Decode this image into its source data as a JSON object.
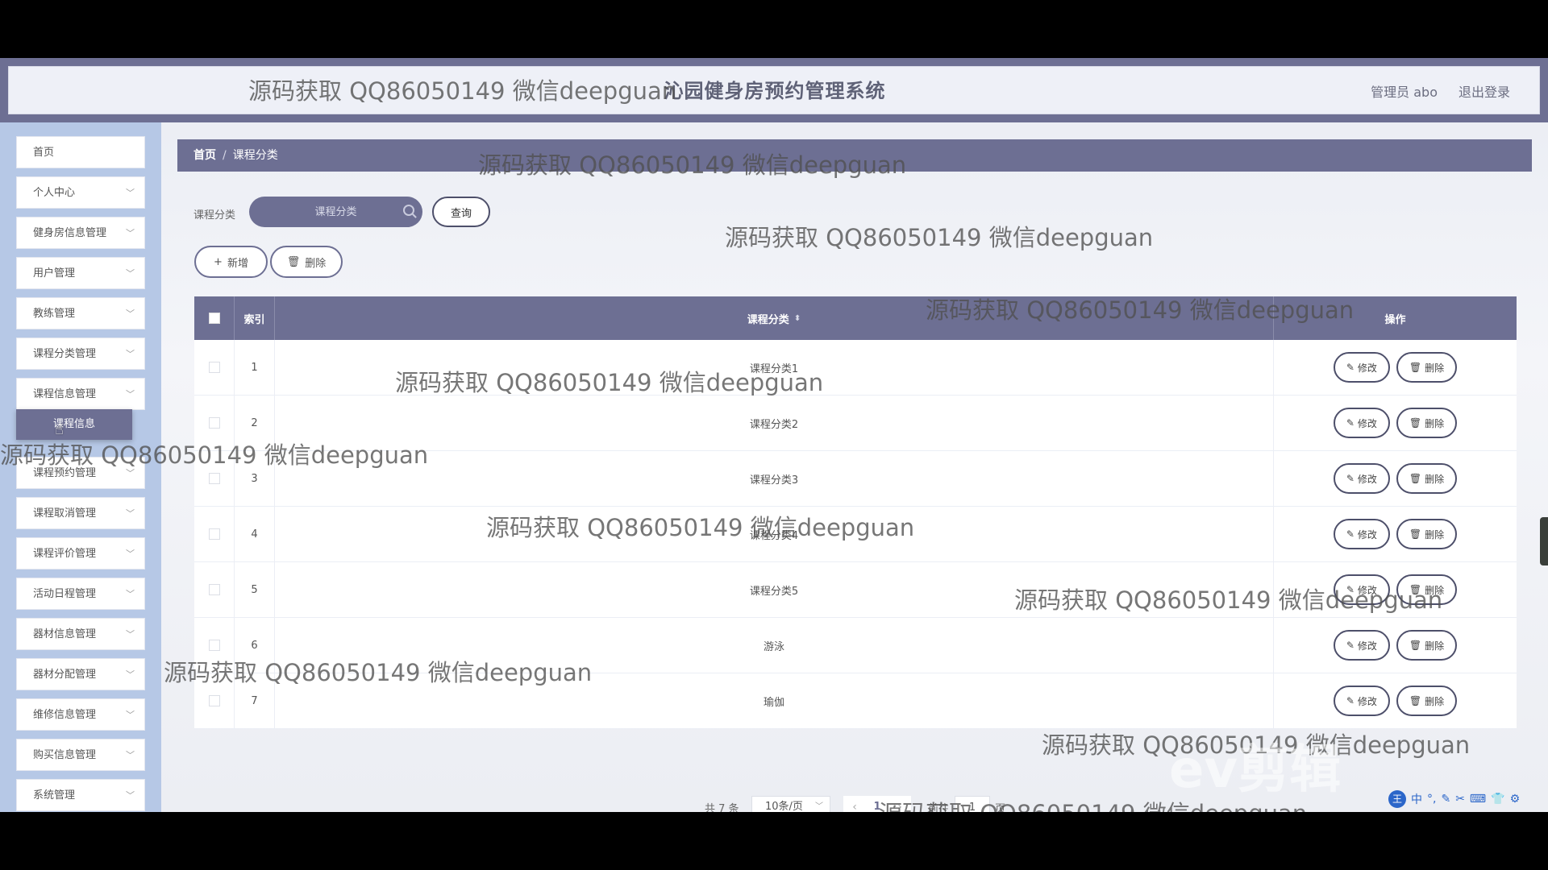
{
  "header": {
    "app_title": "沁园健身房预约管理系统",
    "admin_label": "管理员 abo",
    "logout_label": "退出登录"
  },
  "sidebar": {
    "items": [
      {
        "label": "首页"
      },
      {
        "label": "个人中心"
      },
      {
        "label": "健身房信息管理"
      },
      {
        "label": "用户管理"
      },
      {
        "label": "教练管理"
      },
      {
        "label": "课程分类管理"
      },
      {
        "label": "课程信息管理"
      },
      {
        "label": "课程预约管理"
      },
      {
        "label": "课程取消管理"
      },
      {
        "label": "课程评价管理"
      },
      {
        "label": "活动日程管理"
      },
      {
        "label": "器材信息管理"
      },
      {
        "label": "器材分配管理"
      },
      {
        "label": "维修信息管理"
      },
      {
        "label": "购买信息管理"
      },
      {
        "label": "系统管理"
      }
    ],
    "submenu_label": "课程信息"
  },
  "breadcrumb": {
    "home": "首页",
    "separator": "/",
    "current": "课程分类"
  },
  "search": {
    "label": "课程分类",
    "placeholder": "课程分类",
    "query_label": "查询"
  },
  "actions": {
    "add_label": "新增",
    "delete_label": "删除"
  },
  "table": {
    "headers": {
      "index": "索引",
      "name": "课程分类",
      "ops": "操作"
    },
    "rows": [
      {
        "index": "1",
        "name": "课程分类1"
      },
      {
        "index": "2",
        "name": "课程分类2"
      },
      {
        "index": "3",
        "name": "课程分类3"
      },
      {
        "index": "4",
        "name": "课程分类4"
      },
      {
        "index": "5",
        "name": "课程分类5"
      },
      {
        "index": "6",
        "name": "游泳"
      },
      {
        "index": "7",
        "name": "瑜伽"
      }
    ],
    "edit_label": "修改",
    "delete_label": "删除"
  },
  "pagination": {
    "total": "共 7 条",
    "page_size": "10条/页",
    "current_page": "1",
    "goto_label": "前往",
    "goto_value": "1",
    "goto_suffix": "页"
  },
  "watermark": "源码获取 QQ86050149 微信deepguan",
  "ev_logo": "ev剪辑",
  "colors": {
    "primary": "#6d6f93",
    "sidebar_bg": "#b6c8e6",
    "header_inner": "#eef0f7"
  }
}
